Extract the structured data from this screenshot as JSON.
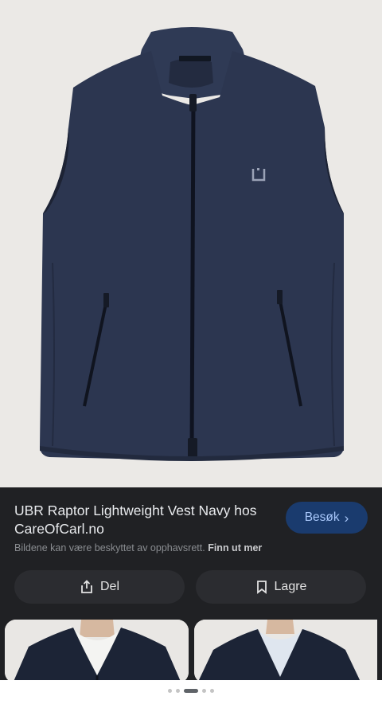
{
  "result": {
    "title": "UBR Raptor Lightweight Vest Navy hos CareOfCarl.no",
    "visit_label": "Besøk",
    "copyright_notice": "Bildene kan være beskyttet av opphavsrett.",
    "learn_more": "Finn ut mer",
    "share_label": "Del",
    "save_label": "Lagre"
  },
  "pagination": {
    "dot_count": 5,
    "active_index": 2
  },
  "colors": {
    "panel_background": "#202124",
    "visit_button_background": "#1a3b6e",
    "visit_button_text": "#a8c7fa",
    "vest_navy": "#2c3650",
    "photo_background": "#ebe9e6"
  },
  "icons": {
    "visit": "chevron-right-icon",
    "share": "share-icon",
    "save": "bookmark-icon"
  }
}
